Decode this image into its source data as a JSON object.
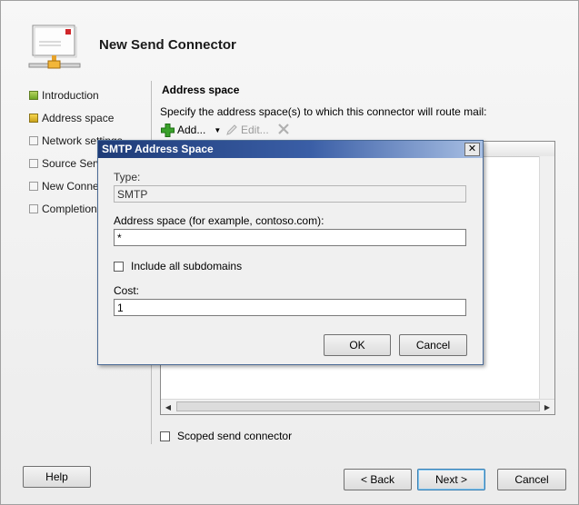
{
  "wizard": {
    "title": "New Send Connector",
    "nav": [
      {
        "label": "Introduction",
        "state": "complete"
      },
      {
        "label": "Address space",
        "state": "current"
      },
      {
        "label": "Network settings",
        "state": "pending"
      },
      {
        "label": "Source Server",
        "state": "pending"
      },
      {
        "label": "New Connector",
        "state": "pending"
      },
      {
        "label": "Completion",
        "state": "pending"
      }
    ],
    "content": {
      "title": "Address space",
      "instructions": "Specify the address space(s) to which this connector will route mail:",
      "toolbar": {
        "add": "Add...",
        "edit": "Edit..."
      },
      "scoped_label": "Scoped send connector"
    },
    "buttons": {
      "help": "Help",
      "back": "< Back",
      "next": "Next >",
      "cancel": "Cancel"
    }
  },
  "dialog": {
    "title": "SMTP Address Space",
    "close_glyph": "✕",
    "type_label": "Type:",
    "type_value": "SMTP",
    "address_label": "Address space (for example, contoso.com):",
    "address_value": "*",
    "subdomains_label": "Include all subdomains",
    "subdomains_checked": false,
    "cost_label": "Cost:",
    "cost_value": "1",
    "ok": "OK",
    "cancel": "Cancel"
  },
  "colors": {
    "titlebar_dark": "#1f3c78",
    "titlebar_light": "#a9c0e4",
    "add_icon": "#3aa12b"
  }
}
